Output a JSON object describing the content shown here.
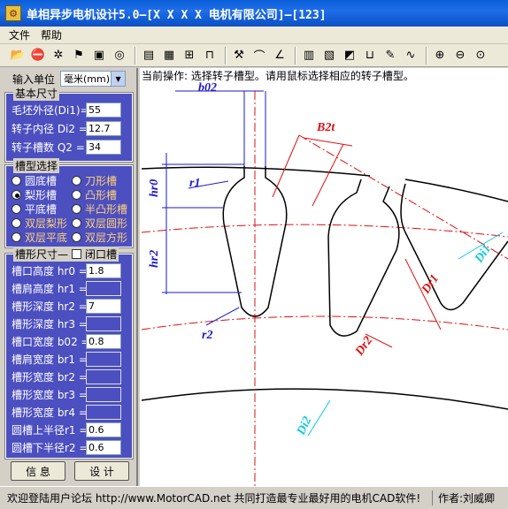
{
  "window": {
    "title": "单相异步电机设计5.0—[X X X X 电机有限公司]—[123]",
    "app_icon": "app-icon"
  },
  "menu": [
    "文件",
    "帮助"
  ],
  "toolbar_icons": [
    "open-icon",
    "stop-icon",
    "settings-icon",
    "flag-icon",
    "save-icon",
    "target-icon",
    "sep",
    "document-icon",
    "grid-icon",
    "zoom-region-icon",
    "slot-icon",
    "sep",
    "wrench-icon",
    "curve-icon",
    "chart-icon",
    "sep",
    "calculator-icon",
    "book-icon",
    "color-icon",
    "magnet-icon",
    "edit-icon",
    "graph-icon",
    "sep",
    "zoom-in-icon",
    "zoom-out-icon",
    "zoom-icon"
  ],
  "unit": {
    "label": "输入单位",
    "value": "毫米(mm)"
  },
  "basic_size": {
    "caption": "基本尺寸",
    "fields": [
      {
        "label": "毛坯外径(Di1)=",
        "value": "55"
      },
      {
        "label": "转子内径 Di2 =",
        "value": "12.7"
      },
      {
        "label": "转子槽数  Q2 =",
        "value": "34"
      }
    ]
  },
  "slot_type": {
    "caption": "槽型选择",
    "options": [
      {
        "label": "圆底槽",
        "selected": false,
        "dim": false
      },
      {
        "label": "刀形槽",
        "selected": false,
        "dim": true
      },
      {
        "label": "梨形槽",
        "selected": true,
        "dim": false
      },
      {
        "label": "凸形槽",
        "selected": false,
        "dim": true
      },
      {
        "label": "平底槽",
        "selected": false,
        "dim": false
      },
      {
        "label": "半凸形槽",
        "selected": false,
        "dim": true
      },
      {
        "label": "双层梨形",
        "selected": false,
        "dim": true
      },
      {
        "label": "双层圆形",
        "selected": false,
        "dim": true
      },
      {
        "label": "双层平底",
        "selected": false,
        "dim": true
      },
      {
        "label": "双层方形",
        "selected": false,
        "dim": true
      }
    ]
  },
  "slot_size": {
    "caption": "槽形尺寸—",
    "closed_label": "闭口槽",
    "fields": [
      {
        "label": "槽口高度 hr0 =",
        "value": "1.8"
      },
      {
        "label": "槽肩高度 hr1 =",
        "value": ""
      },
      {
        "label": "槽形深度 hr2 =",
        "value": "7"
      },
      {
        "label": "槽形深度 hr3 =",
        "value": ""
      },
      {
        "label": "槽口宽度 b02 =",
        "value": "0.8"
      },
      {
        "label": "槽肩宽度 br1 =",
        "value": ""
      },
      {
        "label": "槽形宽度 br2 =",
        "value": ""
      },
      {
        "label": "槽形宽度 br3 =",
        "value": ""
      },
      {
        "label": "槽形宽度 br4 =",
        "value": ""
      },
      {
        "label": "圆槽上半径r1 =",
        "value": "0.6"
      },
      {
        "label": "圆槽下半径r2 =",
        "value": "0.6"
      }
    ]
  },
  "buttons": {
    "info": "信  息",
    "design": "设  计"
  },
  "current_op": "当前操作: 选择转子槽型。请用鼠标选择相应的转子槽型。",
  "drawing_labels": {
    "b02": "b02",
    "b2t": "B2t",
    "r1": "r1",
    "r2": "r2",
    "hr0": "hr0",
    "hr2": "hr2",
    "dr1": "Dr1",
    "dr2": "Dr2",
    "di1": "Di1",
    "di2": "Di2"
  },
  "colors": {
    "title": "#0b4fc4",
    "panel": "#4c4fbf",
    "dim_blue": "#1a1acc",
    "dim_red": "#e01010",
    "dim_cyan": "#10c8e0"
  },
  "status": {
    "left": "欢迎登陆用户论坛 http://www.MotorCAD.net 共同打造最专业最好用的电机CAD软件!",
    "right": "作者:刘威卿"
  }
}
